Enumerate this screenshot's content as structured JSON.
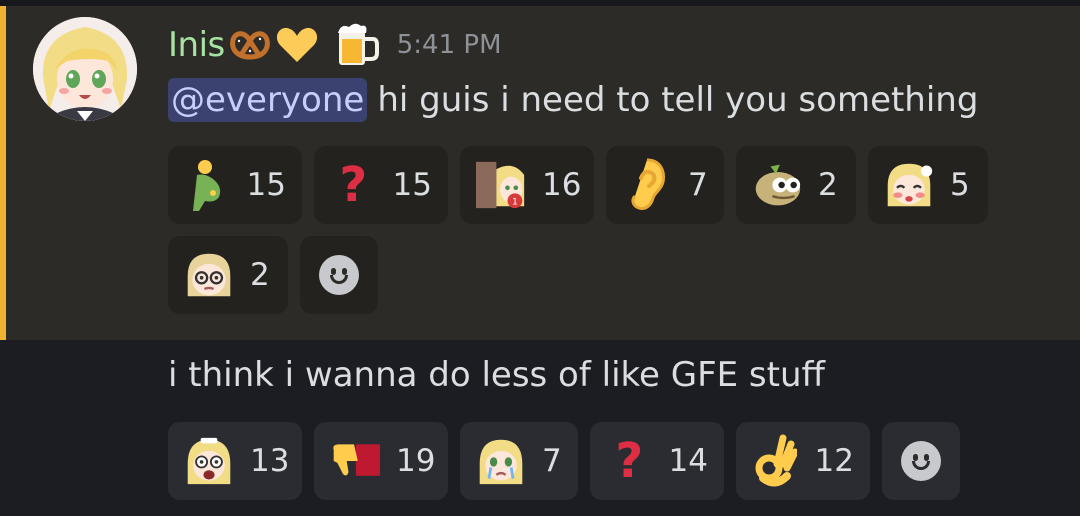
{
  "message1": {
    "username": "Inis",
    "name_emojis": [
      "pretzel",
      "yellow-heart"
    ],
    "badge": "beer-mug",
    "timestamp": "5:41 PM",
    "mention": "@everyone",
    "text": "hi guis i need to tell you something",
    "reactions": [
      {
        "icon": "pregnant-person-emoji",
        "count": "15"
      },
      {
        "icon": "red-question-mark-emoji",
        "count": "15"
      },
      {
        "icon": "anime-girl-notification-emoji",
        "count": "16"
      },
      {
        "icon": "ear-emoji",
        "count": "7"
      },
      {
        "icon": "peanut-creature-emoji",
        "count": "2"
      },
      {
        "icon": "anime-girl-blush-emoji",
        "count": "5"
      },
      {
        "icon": "anime-girl-glasses-emoji",
        "count": "2"
      }
    ]
  },
  "message2": {
    "text": "i think i wanna do less of like GFE stuff",
    "reactions": [
      {
        "icon": "anime-girl-shocked-emoji",
        "count": "13"
      },
      {
        "icon": "thumbs-down-emoji",
        "count": "19"
      },
      {
        "icon": "anime-girl-crying-emoji",
        "count": "7"
      },
      {
        "icon": "red-question-mark-emoji",
        "count": "14"
      },
      {
        "icon": "ok-hand-emoji",
        "count": "12"
      }
    ]
  },
  "colors": {
    "username": "#a6e3a1",
    "mention_bg": "#3c4270",
    "mention_bar": "#f0b232",
    "highlight_bg": "#2d2b27",
    "background": "#1c1d22"
  }
}
